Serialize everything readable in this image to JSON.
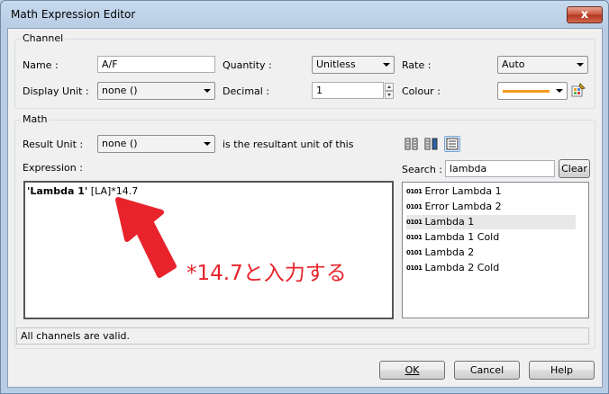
{
  "window": {
    "title": "Math Expression Editor",
    "close_label": "x"
  },
  "channel": {
    "legend": "Channel",
    "name_label": "Name :",
    "name_value": "A/F",
    "display_unit_label": "Display Unit :",
    "display_unit_value": "none ()",
    "quantity_label": "Quantity :",
    "quantity_value": "Unitless",
    "decimal_label": "Decimal :",
    "decimal_value": "1",
    "rate_label": "Rate :",
    "rate_value": "Auto",
    "colour_label": "Colour :",
    "colour_value": "#f79a1e"
  },
  "math": {
    "legend": "Math",
    "result_unit_label": "Result Unit :",
    "result_unit_value": "none ()",
    "result_unit_hint": "is the resultant unit of this",
    "expression_label": "Expression :",
    "expression_bold": "'Lambda 1'",
    "expression_rest": " [LA]*14.7",
    "search_label": "Search :",
    "search_value": "lambda",
    "clear_label": "Clear",
    "list_bin_glyph": "0101",
    "channels": [
      "Error Lambda 1",
      "Error Lambda 2",
      "Lambda 1",
      "Lambda 1 Cold",
      "Lambda 2",
      "Lambda 2 Cold"
    ],
    "selected_index": 2
  },
  "status": "All channels are valid.",
  "buttons": {
    "ok": "OK",
    "cancel": "Cancel",
    "help": "Help"
  },
  "annotation": {
    "text": "*14.7と入力する",
    "color": "#e8232b"
  }
}
